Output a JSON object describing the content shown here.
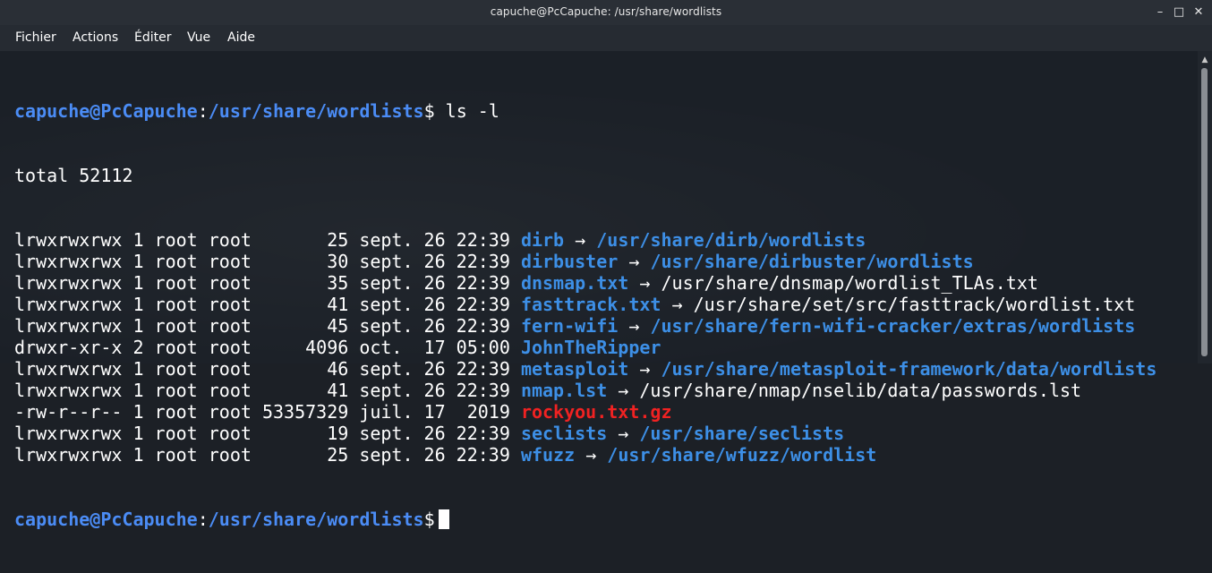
{
  "window": {
    "title": "capuche@PcCapuche: /usr/share/wordlists",
    "controls": {
      "minimize": "–",
      "maximize": "□",
      "close": "✕"
    }
  },
  "menu": [
    "Fichier",
    "Actions",
    "Éditer",
    "Vue",
    "Aide"
  ],
  "prompt": {
    "user_host": "capuche@PcCapuche",
    "separator": ":",
    "path": "/usr/share/wordlists",
    "sign": "$"
  },
  "command": "ls -l",
  "total": "total 52112",
  "entries": [
    {
      "meta": "lrwxrwxrwx 1 root root       25 sept. 26 22:39 ",
      "name": "dirb",
      "arrow": " → ",
      "target": "/usr/share/dirb/wordlists",
      "name_color": "blue",
      "target_color": "blue"
    },
    {
      "meta": "lrwxrwxrwx 1 root root       30 sept. 26 22:39 ",
      "name": "dirbuster",
      "arrow": " → ",
      "target": "/usr/share/dirbuster/wordlists",
      "name_color": "blue",
      "target_color": "blue"
    },
    {
      "meta": "lrwxrwxrwx 1 root root       35 sept. 26 22:39 ",
      "name": "dnsmap.txt",
      "arrow": " → ",
      "target": "/usr/share/dnsmap/wordlist_TLAs.txt",
      "name_color": "blue",
      "target_color": "plain"
    },
    {
      "meta": "lrwxrwxrwx 1 root root       41 sept. 26 22:39 ",
      "name": "fasttrack.txt",
      "arrow": " → ",
      "target": "/usr/share/set/src/fasttrack/wordlist.txt",
      "name_color": "blue",
      "target_color": "plain"
    },
    {
      "meta": "lrwxrwxrwx 1 root root       45 sept. 26 22:39 ",
      "name": "fern-wifi",
      "arrow": " → ",
      "target": "/usr/share/fern-wifi-cracker/extras/wordlists",
      "name_color": "blue",
      "target_color": "blue"
    },
    {
      "meta": "drwxr-xr-x 2 root root     4096 oct.  17 05:00 ",
      "name": "JohnTheRipper",
      "arrow": "",
      "target": "",
      "name_color": "blue",
      "target_color": "plain"
    },
    {
      "meta": "lrwxrwxrwx 1 root root       46 sept. 26 22:39 ",
      "name": "metasploit",
      "arrow": " → ",
      "target": "/usr/share/metasploit-framework/data/wordlists",
      "name_color": "blue",
      "target_color": "blue"
    },
    {
      "meta": "lrwxrwxrwx 1 root root       41 sept. 26 22:39 ",
      "name": "nmap.lst",
      "arrow": " → ",
      "target": "/usr/share/nmap/nselib/data/passwords.lst",
      "name_color": "blue",
      "target_color": "plain"
    },
    {
      "meta": "-rw-r--r-- 1 root root 53357329 juil. 17  2019 ",
      "name": "rockyou.txt.gz",
      "arrow": "",
      "target": "",
      "name_color": "red",
      "target_color": "plain"
    },
    {
      "meta": "lrwxrwxrwx 1 root root       19 sept. 26 22:39 ",
      "name": "seclists",
      "arrow": " → ",
      "target": "/usr/share/seclists",
      "name_color": "blue",
      "target_color": "blue"
    },
    {
      "meta": "lrwxrwxrwx 1 root root       25 sept. 26 22:39 ",
      "name": "wfuzz",
      "arrow": " → ",
      "target": "/usr/share/wfuzz/wordlist",
      "name_color": "blue",
      "target_color": "blue"
    }
  ],
  "colors": {
    "titlebar": "#2a2f36",
    "menubar": "#262b32",
    "terminal_bg": "#1b2027",
    "prompt": "#4b8cf5",
    "link": "#3d8fe6",
    "archive": "#f02222",
    "text": "#ffffff"
  },
  "icons": {
    "scroll_up": "scroll-up-arrow-icon"
  }
}
